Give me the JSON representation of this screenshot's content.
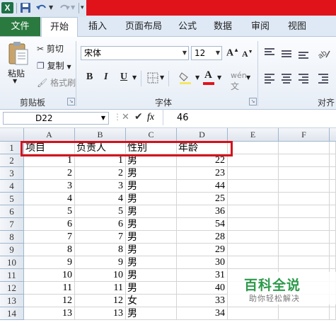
{
  "quick_access": {
    "app_icon": "excel-icon",
    "app_icon_letter": "X",
    "save_icon": "save-icon",
    "undo_icon": "undo-icon",
    "redo_icon": "redo-icon",
    "customize_icon": "customize-quick-access-icon"
  },
  "ribbon_tabs": {
    "file": "文件",
    "items": [
      "开始",
      "插入",
      "页面布局",
      "公式",
      "数据",
      "审阅",
      "视图"
    ],
    "active": "开始"
  },
  "clipboard": {
    "paste": "粘贴",
    "cut": "剪切",
    "copy": "复制",
    "format_painter": "格式刷",
    "group_label": "剪贴板"
  },
  "font": {
    "family": "宋体",
    "size": "12",
    "bold": "B",
    "italic": "I",
    "underline": "U",
    "grow": "A",
    "shrink": "A",
    "font_color_letter": "A",
    "font_color": "#e0131b",
    "group_label": "字体"
  },
  "alignment": {
    "group_label": "对齐"
  },
  "formula_bar": {
    "name_box": "D22",
    "fx": "fx",
    "value": "46"
  },
  "sheet": {
    "columns": [
      "A",
      "B",
      "C",
      "D",
      "E",
      "F"
    ],
    "rows": [
      {
        "n": "1",
        "a": "项目",
        "b": "负责人",
        "c": "性别",
        "d": "年龄"
      },
      {
        "n": "2",
        "a": "1",
        "b": "1",
        "c": "男",
        "d": "22"
      },
      {
        "n": "3",
        "a": "2",
        "b": "2",
        "c": "男",
        "d": "23"
      },
      {
        "n": "4",
        "a": "3",
        "b": "3",
        "c": "男",
        "d": "44"
      },
      {
        "n": "5",
        "a": "4",
        "b": "4",
        "c": "男",
        "d": "25"
      },
      {
        "n": "6",
        "a": "5",
        "b": "5",
        "c": "男",
        "d": "36"
      },
      {
        "n": "7",
        "a": "6",
        "b": "6",
        "c": "男",
        "d": "54"
      },
      {
        "n": "8",
        "a": "7",
        "b": "7",
        "c": "男",
        "d": "28"
      },
      {
        "n": "9",
        "a": "8",
        "b": "8",
        "c": "男",
        "d": "29"
      },
      {
        "n": "10",
        "a": "9",
        "b": "9",
        "c": "男",
        "d": "30"
      },
      {
        "n": "11",
        "a": "10",
        "b": "10",
        "c": "男",
        "d": "31"
      },
      {
        "n": "12",
        "a": "11",
        "b": "11",
        "c": "男",
        "d": "40"
      },
      {
        "n": "13",
        "a": "12",
        "b": "12",
        "c": "女",
        "d": "33"
      },
      {
        "n": "14",
        "a": "13",
        "b": "13",
        "c": "男",
        "d": "34"
      }
    ]
  },
  "watermark": {
    "main": "百科全说",
    "sub": "助你轻松解决"
  }
}
